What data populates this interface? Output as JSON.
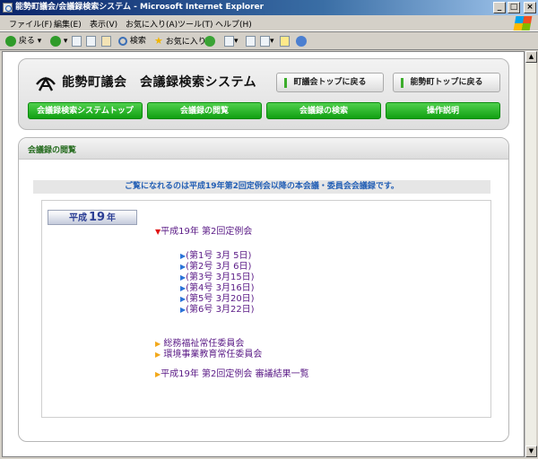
{
  "window": {
    "title": "能勢町議会/会議録検索システム - Microsoft Internet Explorer",
    "controls": [
      "_",
      "□",
      "×"
    ]
  },
  "menu": [
    "ファイル(F)",
    "編集(E)",
    "表示(V)",
    "お気に入り(A)",
    "ツール(T)",
    "ヘルプ(H)"
  ],
  "toolbar": {
    "back_label": "戻る",
    "search_label": "検索",
    "favorites_label": "お気に入り"
  },
  "header": {
    "site_title": "能勢町議会　会議録検索システム",
    "top_buttons": [
      "町議会トップに戻る",
      "能勢町トップに戻る"
    ],
    "nav": [
      "会議録検索システムトップ",
      "会議録の閲覧",
      "会議録の検索",
      "操作説明"
    ]
  },
  "section": {
    "title": "会議録の閲覧",
    "notice": "ご覧になれるのは平成19年第2回定例会以降の本会議・委員会会議録です。"
  },
  "year_tab": {
    "era": "平成",
    "number": "19",
    "suffix": "年"
  },
  "meeting": {
    "marker": "▼",
    "title": "平成19年 第2回定例会",
    "sessions": [
      "(第1号 3月 5日)",
      "(第2号 3月 6日)",
      "(第3号 3月15日)",
      "(第4号 3月16日)",
      "(第5号 3月20日)",
      "(第6号 3月22日)"
    ],
    "committees": [
      "総務福祉常任委員会",
      "環境事業教育常任委員会"
    ],
    "results": "平成19年 第2回定例会 審議結果一覧"
  },
  "colors": {
    "title_bar": "#0a246a",
    "nav_green": "#11a012",
    "link": "#5a1a86",
    "notice_text": "#235fb5",
    "section_title": "#236a1c"
  }
}
